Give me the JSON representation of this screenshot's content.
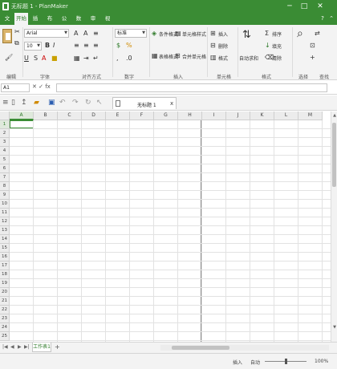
{
  "window": {
    "title": "无标题 1 - PlanMaker",
    "help_glyph": "?",
    "min_glyph": "─",
    "max_glyph": "□",
    "close_glyph": "✕"
  },
  "menu_tabs": [
    {
      "label": "文件",
      "active": false
    },
    {
      "label": "开始",
      "active": true
    },
    {
      "label": "插入",
      "active": false
    },
    {
      "label": "布局",
      "active": false
    },
    {
      "label": "公式",
      "active": false
    },
    {
      "label": "数据",
      "active": false
    },
    {
      "label": "审阅",
      "active": false
    },
    {
      "label": "视图",
      "active": false
    }
  ],
  "ribbon": {
    "font_name": "Arial",
    "font_size": "10",
    "number_format": "标准",
    "buttons": {
      "conditional_format": "条件格式",
      "cell_style": "单元格样式",
      "insert_row": "插入",
      "delete_row": "删除",
      "format": "格式",
      "filter": "筛选",
      "sort": "排序",
      "find": "查找",
      "fill": "填充",
      "clear": "清除",
      "autosum": "自动求和",
      "table_format": "表格格式",
      "merge": "合并单元格"
    },
    "groups": {
      "edit": "编辑",
      "font": "字体",
      "alignment": "对齐方式",
      "number": "数字",
      "insert": "插入",
      "cells": "单元格",
      "format": "格式",
      "select": "选择",
      "search": "查找"
    }
  },
  "formula_bar": {
    "cell_ref": "A1",
    "cancel_glyph": "✕",
    "confirm_glyph": "✓",
    "fx_glyph": "fx",
    "value": ""
  },
  "document_tab": {
    "title": "无标题 1",
    "close_glyph": "x"
  },
  "sheet": {
    "columns": [
      "A",
      "B",
      "C",
      "D",
      "E",
      "F",
      "G",
      "H",
      "I",
      "J",
      "K",
      "L",
      "M"
    ],
    "rows": [
      "1",
      "2",
      "3",
      "4",
      "5",
      "6",
      "7",
      "8",
      "9",
      "10",
      "11",
      "12",
      "13",
      "14",
      "15",
      "16",
      "17",
      "18",
      "19",
      "20",
      "21",
      "22",
      "23",
      "24",
      "25"
    ],
    "selected_col": "A",
    "selected_row": "1"
  },
  "sheet_tabs": [
    {
      "label": "工作表1",
      "active": true
    }
  ],
  "add_sheet_glyph": "+",
  "statusbar": {
    "mode": "插入",
    "autosave": "自动",
    "zoom": "100%"
  },
  "colors": {
    "accent": "#3a8c34",
    "ribbon_bg": "#f3f3f3"
  }
}
